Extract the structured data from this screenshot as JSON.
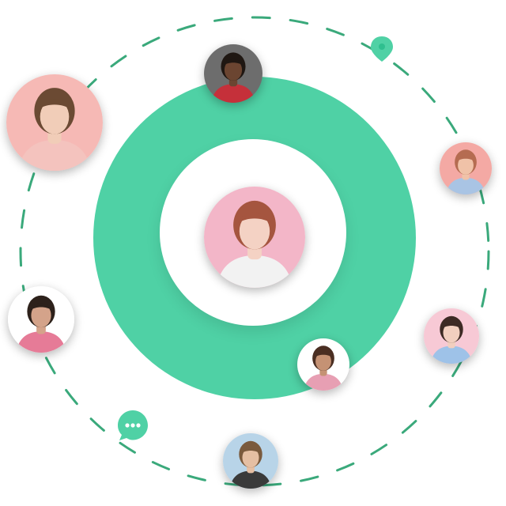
{
  "colors": {
    "accent": "#4fd1a5",
    "accent_dark": "#2fbf8f",
    "dash": "#3aa97b",
    "background": "#ffffff"
  },
  "icons": {
    "location": "location-pin-icon",
    "chat": "chat-bubble-icon"
  },
  "avatars": [
    {
      "id": "center-user",
      "bg": "#f3b6c8",
      "skin": "#f4d2c4",
      "hair": "#a5553f",
      "shirt": "#f2f2f2"
    },
    {
      "id": "top-user",
      "bg": "#6d6d6d",
      "skin": "#6b4531",
      "hair": "#1f1712",
      "shirt": "#c5303a"
    },
    {
      "id": "top-left-user",
      "bg": "#f6b9b5",
      "skin": "#f1cdb8",
      "hair": "#6b4a33",
      "shirt": "#f4c3be"
    },
    {
      "id": "right-upper-user",
      "bg": "#f4a9a4",
      "skin": "#f0c2a8",
      "hair": "#b56c51",
      "shirt": "#a9c4e4"
    },
    {
      "id": "left-user",
      "bg": "#ffffff",
      "skin": "#d4a38a",
      "hair": "#2d211b",
      "shirt": "#e67b97"
    },
    {
      "id": "right-lower-user",
      "bg": "#f7c9d5",
      "skin": "#f2cfbf",
      "hair": "#3d2a24",
      "shirt": "#9ec2e8"
    },
    {
      "id": "lower-middle-user",
      "bg": "#ffffff",
      "skin": "#c59274",
      "hair": "#4a2e22",
      "shirt": "#e79fb3"
    },
    {
      "id": "bottom-user",
      "bg": "#b8d4e8",
      "skin": "#e5bfa3",
      "hair": "#7a5a3d",
      "shirt": "#3a3a3a"
    }
  ]
}
